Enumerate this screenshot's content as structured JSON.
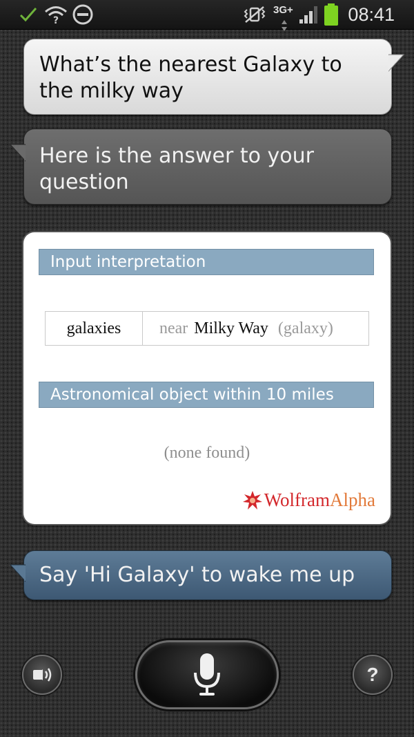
{
  "status_bar": {
    "time": "08:41",
    "network": "3G+",
    "battery_color": "#7ed321"
  },
  "conversation": {
    "user_query": "What’s the nearest Galaxy to the milky way",
    "assistant_reply": "Here is the answer to your question"
  },
  "result_card": {
    "pod1_title": "Input interpretation",
    "interp_term": "galaxies",
    "interp_near": "near",
    "interp_object": "Milky Way",
    "interp_type": "(galaxy)",
    "pod2_title": "Astronomical object within 10 miles",
    "pod2_value": "(none found)",
    "logo_wolfram": "Wolfram",
    "logo_alpha": "Alpha"
  },
  "wake_hint": "Say 'Hi Galaxy' to wake me up",
  "controls": {
    "help_label": "?"
  },
  "icons": {
    "status_left": [
      "check-icon",
      "wifi-question-icon",
      "do-not-disturb-icon"
    ],
    "status_right": [
      "vibrate-icon",
      "signal-icon",
      "battery-icon"
    ],
    "bottom": [
      "speaker-icon",
      "microphone-icon",
      "help-icon"
    ]
  }
}
